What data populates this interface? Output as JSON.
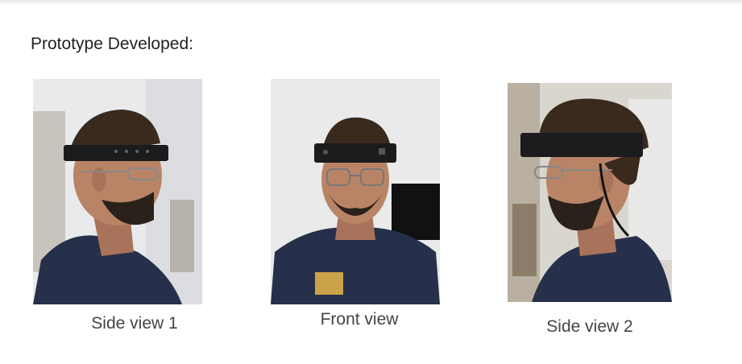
{
  "document": {
    "heading": "Prototype Developed:"
  },
  "photos": [
    {
      "caption": "Side view 1",
      "view": "left-profile"
    },
    {
      "caption": "Front view",
      "view": "front"
    },
    {
      "caption": "Side view 2",
      "view": "right-profile"
    }
  ],
  "colors": {
    "text": "#222222",
    "caption": "#444444",
    "headband": "#1c1c1e",
    "shirt": "#27304a",
    "skin": "#b98466",
    "hair": "#3a2a1e"
  }
}
